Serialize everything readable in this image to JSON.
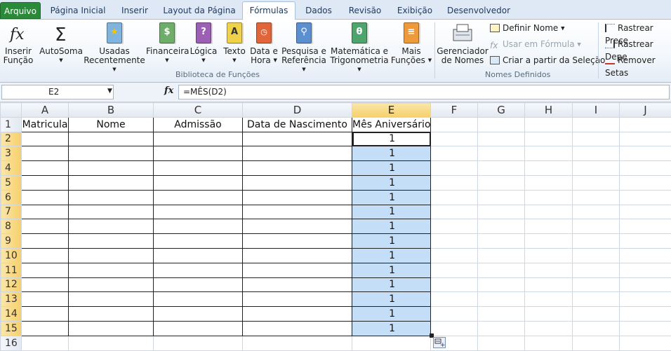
{
  "tabs": [
    "Arquivo",
    "Página Inicial",
    "Inserir",
    "Layout da Página",
    "Fórmulas",
    "Dados",
    "Revisão",
    "Exibição",
    "Desenvolvedor"
  ],
  "active_tab": "Fórmulas",
  "ribbon": {
    "insert_function": [
      "Inserir",
      "Função"
    ],
    "autosum": "AutoSoma",
    "recent": [
      "Usadas",
      "Recentemente"
    ],
    "financial": "Financeira",
    "logical": "Lógica",
    "text": "Texto",
    "datetime": [
      "Data e",
      "Hora"
    ],
    "lookup": [
      "Pesquisa e",
      "Referência"
    ],
    "math": [
      "Matemática e",
      "Trigonometria"
    ],
    "more": [
      "Mais",
      "Funções"
    ],
    "library_group": "Biblioteca de Funções",
    "name_manager": [
      "Gerenciador",
      "de Nomes"
    ],
    "define_name": "Definir Nome",
    "use_in_formula": "Usar em Fórmula",
    "create_from_selection": "Criar a partir da Seleção",
    "names_group": "Nomes Definidos",
    "trace_precedents": "Rastrear Prece",
    "trace_dependents": "Rastrear Depe",
    "remove_arrows": "Remover Setas"
  },
  "name_box": "E2",
  "fx_label": "fx",
  "formula": "=MÊS(D2)",
  "columns": [
    "A",
    "B",
    "C",
    "D",
    "E",
    "F",
    "G",
    "H",
    "I",
    "J"
  ],
  "selected_column": "E",
  "row_numbers": [
    "1",
    "2",
    "3",
    "4",
    "5",
    "6",
    "7",
    "8",
    "9",
    "10",
    "11",
    "12",
    "13",
    "14",
    "15",
    "16"
  ],
  "headers": {
    "A": "Matricula",
    "B": "Nome",
    "C": "Admissão",
    "D": "Data de Nascimento",
    "E": "Mês Aniversário"
  },
  "e_values": [
    "1",
    "1",
    "1",
    "1",
    "1",
    "1",
    "1",
    "1",
    "1",
    "1",
    "1",
    "1",
    "1",
    "1"
  ],
  "colors": {
    "file_tab": "#2a8a3a",
    "selection": "#c5def8",
    "selected_header": "#f6cf6b"
  }
}
